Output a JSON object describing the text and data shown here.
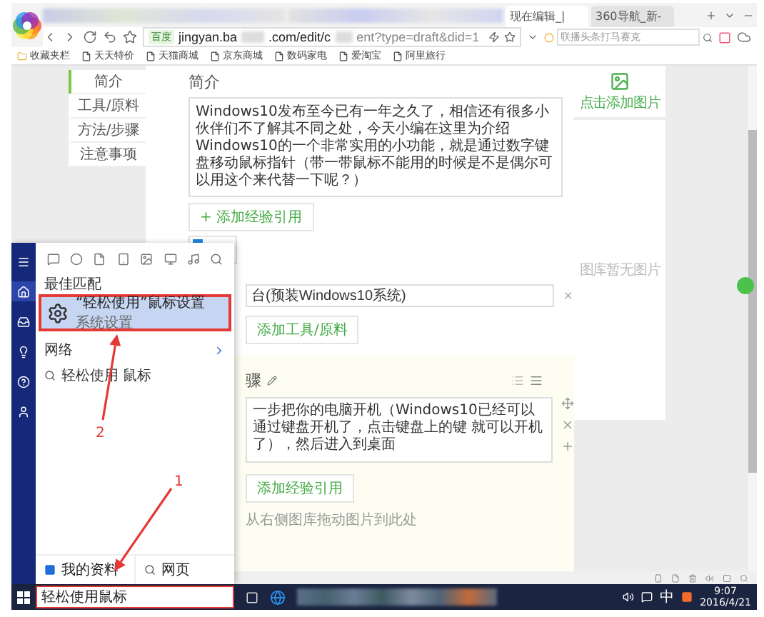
{
  "browser": {
    "tabs": [
      {
        "label": "现在编辑_|",
        "selected": true
      },
      {
        "label": "360导航_新-",
        "selected": false
      }
    ],
    "address": {
      "badge": "百度",
      "url_parts": [
        "jingyan.ba",
        ".com/edit/c",
        "ent?type=draft&did=1"
      ]
    },
    "search": {
      "placeholder": "联播头条打马赛克"
    },
    "bookmarks": [
      "收藏夹栏",
      "天天特价",
      "天猫商城",
      "京东商城",
      "数码家电",
      "爱淘宝",
      "阿里旅行"
    ]
  },
  "page": {
    "nav": [
      {
        "label": "简介",
        "selected": true
      },
      {
        "label": "工具/原料",
        "selected": false
      },
      {
        "label": "方法/步骤",
        "selected": false
      },
      {
        "label": "注意事项",
        "selected": false
      }
    ],
    "intro": {
      "heading": "简介",
      "text": "Windows10发布至今已有一年之久了，相信还有很多小伙伴们不了解其不同之处，今天小编在这里为介绍Windows10的一个非常实用的小功能，就是通过数字键盘移动鼠标指针（带一带鼠标不能用的时候是不是偶尔可以用这个来代替一下呢？）",
      "add_button": "+ 添加经验引用"
    },
    "image_panel": {
      "add_label": "点击添加图片",
      "empty_label": "图库暂无图片"
    },
    "tool": {
      "value": "台(预装Windows10系统)",
      "add_button": "添加工具/原料"
    },
    "step": {
      "heading": "骤",
      "text": "一步把你的电脑开机（Windows10已经可以通过键盘开机了，点击键盘上的键 就可以开机了），然后进入到桌面",
      "add_button": "添加经验引用",
      "hint": "从右侧图库拖动图片到此处"
    }
  },
  "start_menu": {
    "section": "最佳匹配",
    "best": {
      "title": "“轻松使用”鼠标设置",
      "subtitle": "系统设置",
      "selected": true,
      "annotated": true
    },
    "web_section": "网络",
    "suggestion": "轻松使用 鼠标",
    "bottom": [
      "我的资料",
      "网页"
    ],
    "search": {
      "value": "轻松使用鼠标",
      "annotated": true
    }
  },
  "taskbar": {
    "ime": "中",
    "time": "9:07",
    "date": "2016/4/21"
  },
  "annotations": [
    {
      "label": "1"
    },
    {
      "label": "2"
    }
  ]
}
